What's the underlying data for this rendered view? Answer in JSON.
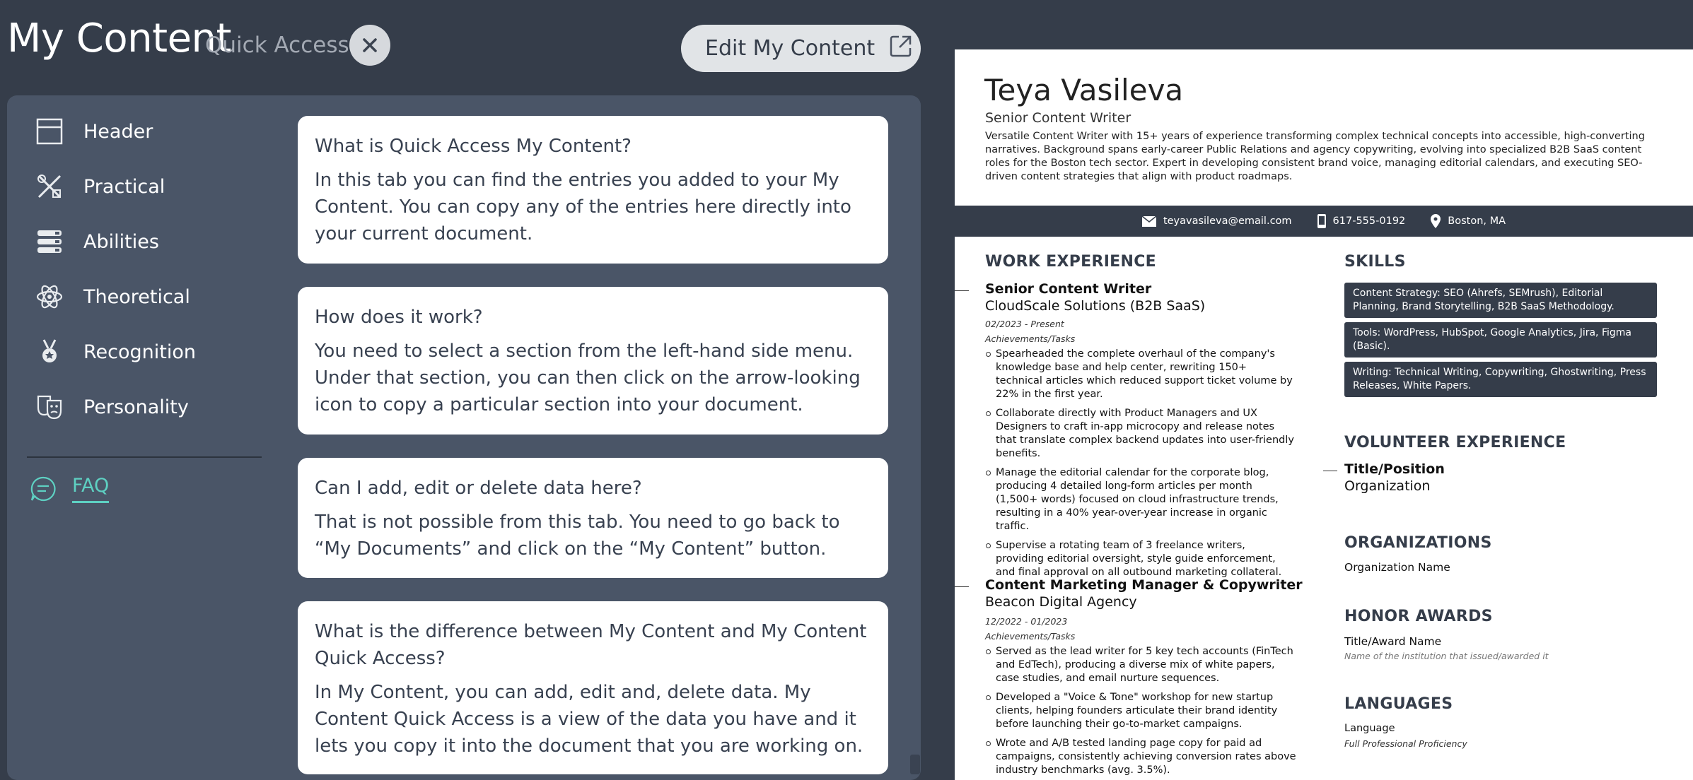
{
  "panel": {
    "title": "My Content",
    "subtitle": "Quick Access",
    "edit_button": "Edit My Content",
    "menu": [
      {
        "label": "Header",
        "icon": "header-icon"
      },
      {
        "label": "Practical",
        "icon": "tools-icon"
      },
      {
        "label": "Abilities",
        "icon": "stack-icon"
      },
      {
        "label": "Theoretical",
        "icon": "atom-icon"
      },
      {
        "label": "Recognition",
        "icon": "medal-icon"
      },
      {
        "label": "Personality",
        "icon": "masks-icon"
      }
    ],
    "faq_label": "FAQ",
    "faqs": [
      {
        "q": "What is Quick Access My Content?",
        "a": "In this tab you can find the entries you added to your My Content. You can copy any of the entries here directly into your current document."
      },
      {
        "q": "How does it work?",
        "a": "You need to select a section from the left-hand side menu. Under that section, you can then click on the arrow-looking icon to copy a particular section into your document."
      },
      {
        "q": "Can I add, edit or delete data here?",
        "a": "That is not possible from this tab. You need to go back to “My Documents” and click on the “My Content” button."
      },
      {
        "q": "What is the difference between My Content and My Content Quick Access?",
        "a": "In My Content, you can add, edit and, delete data. My Content Quick Access is a view of the data you have and it lets you copy it into the document that you are working on."
      }
    ]
  },
  "resume": {
    "name": "Teya Vasileva",
    "role": "Senior Content Writer",
    "summary": "Versatile Content Writer with 15+ years of experience transforming complex technical concepts into accessible, high-converting narratives. Background spans early-career Public Relations and agency copywriting, evolving into specialized B2B SaaS content roles for the Boston tech sector. Expert in developing consistent brand voice, managing editorial calendars, and executing SEO-driven content strategies that align with product roadmaps.",
    "email": "teyavasileva@email.com",
    "phone": "617-555-0192",
    "location": "Boston, MA",
    "work_title": "WORK EXPERIENCE",
    "jobs": [
      {
        "title": "Senior Content Writer",
        "company": "CloudScale Solutions (B2B SaaS)",
        "dates": "02/2023 - Present",
        "ach_label": "Achievements/Tasks",
        "bullets": [
          "Spearheaded the complete overhaul of the company's knowledge base and help center, rewriting 150+ technical articles which reduced support ticket volume by 22% in the first year.",
          "Collaborate directly with Product Managers and UX Designers to craft in-app microcopy and release notes that translate complex backend updates into user-friendly benefits.",
          "Manage the editorial calendar for the corporate blog, producing 4 detailed long-form articles per month (1,500+ words) focused on cloud infrastructure trends, resulting in a 40% year-over-year increase in organic traffic.",
          "Supervise a rotating team of 3 freelance writers, providing editorial oversight, style guide enforcement, and final approval on all outbound marketing collateral."
        ]
      },
      {
        "title": "Content Marketing Manager & Copywriter",
        "company": "Beacon Digital Agency",
        "dates": "12/2022 - 01/2023",
        "ach_label": "Achievements/Tasks",
        "bullets": [
          "Served as the lead writer for 5 key tech accounts (FinTech and EdTech), producing a diverse mix of white papers, case studies, and email nurture sequences.",
          "Developed a \"Voice & Tone\" workshop for new startup clients, helping founders articulate their brand identity before launching their go-to-market campaigns.",
          "Wrote and A/B tested landing page copy for paid ad campaigns, consistently achieving conversion rates above industry benchmarks (avg. 3.5%)."
        ]
      }
    ],
    "skills_title": "SKILLS",
    "skills": [
      "Content Strategy: SEO (Ahrefs, SEMrush), Editorial Planning, Brand Storytelling, B2B SaaS Methodology.",
      "Tools: WordPress, HubSpot, Google Analytics, Jira, Figma (Basic).",
      "Writing: Technical Writing, Copywriting, Ghostwriting, Press Releases, White Papers."
    ],
    "volunteer_title": "VOLUNTEER EXPERIENCE",
    "volunteer_position": "Title/Position",
    "volunteer_org": "Organization",
    "orgs_title": "ORGANIZATIONS",
    "org_name": "Organization Name",
    "awards_title": "HONOR AWARDS",
    "award_name": "Title/Award Name",
    "award_institution": "Name of the institution that issued/awarded it",
    "languages_title": "LANGUAGES",
    "language": "Language",
    "language_level": "Full Professional Proficiency"
  }
}
